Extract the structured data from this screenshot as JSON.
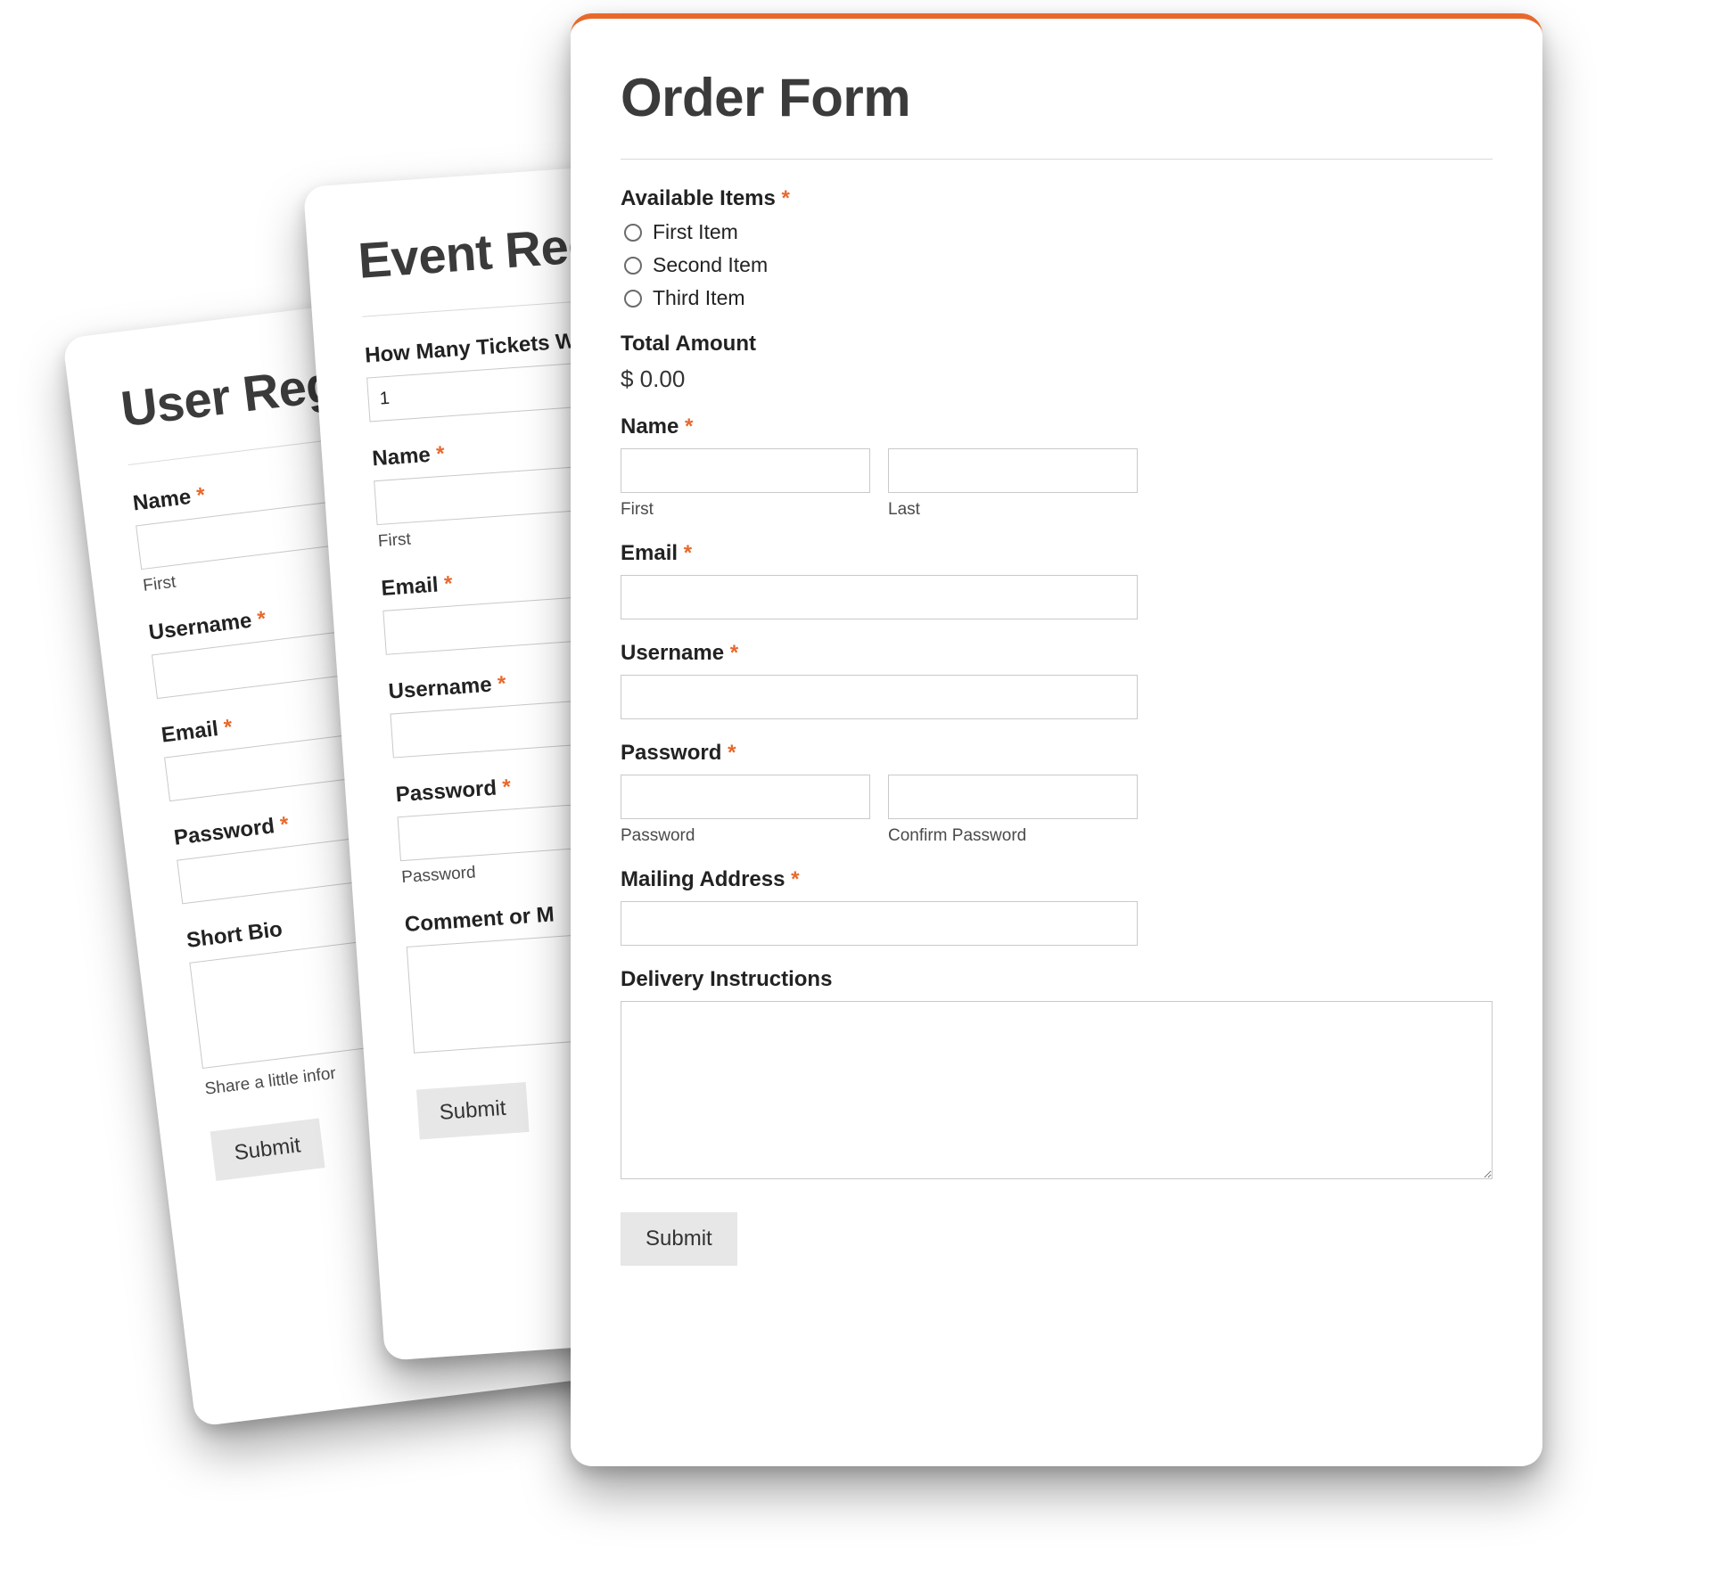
{
  "common": {
    "required_mark": "*",
    "submit_label": "Submit",
    "sub_first": "First",
    "sub_last": "Last",
    "sub_password": "Password",
    "sub_confirm_password": "Confirm Password"
  },
  "card_back": {
    "title": "User Regi",
    "labels": {
      "name": "Name",
      "username": "Username",
      "email": "Email",
      "password": "Password",
      "short_bio": "Short Bio"
    },
    "bio_help_visible": "Share a little infor"
  },
  "card_mid": {
    "title": "Event Reg",
    "labels": {
      "tickets": "How Many Tickets Wo",
      "name": "Name",
      "email": "Email",
      "username": "Username",
      "password": "Password",
      "comment": "Comment or M"
    },
    "tickets_value": "1"
  },
  "card_front": {
    "title": "Order Form",
    "labels": {
      "available_items": "Available Items",
      "total_amount": "Total Amount",
      "name": "Name",
      "email": "Email",
      "username": "Username",
      "password": "Password",
      "mailing_address": "Mailing Address",
      "delivery_instructions": "Delivery Instructions"
    },
    "items": [
      "First Item",
      "Second Item",
      "Third Item"
    ],
    "total_value": "$ 0.00"
  }
}
